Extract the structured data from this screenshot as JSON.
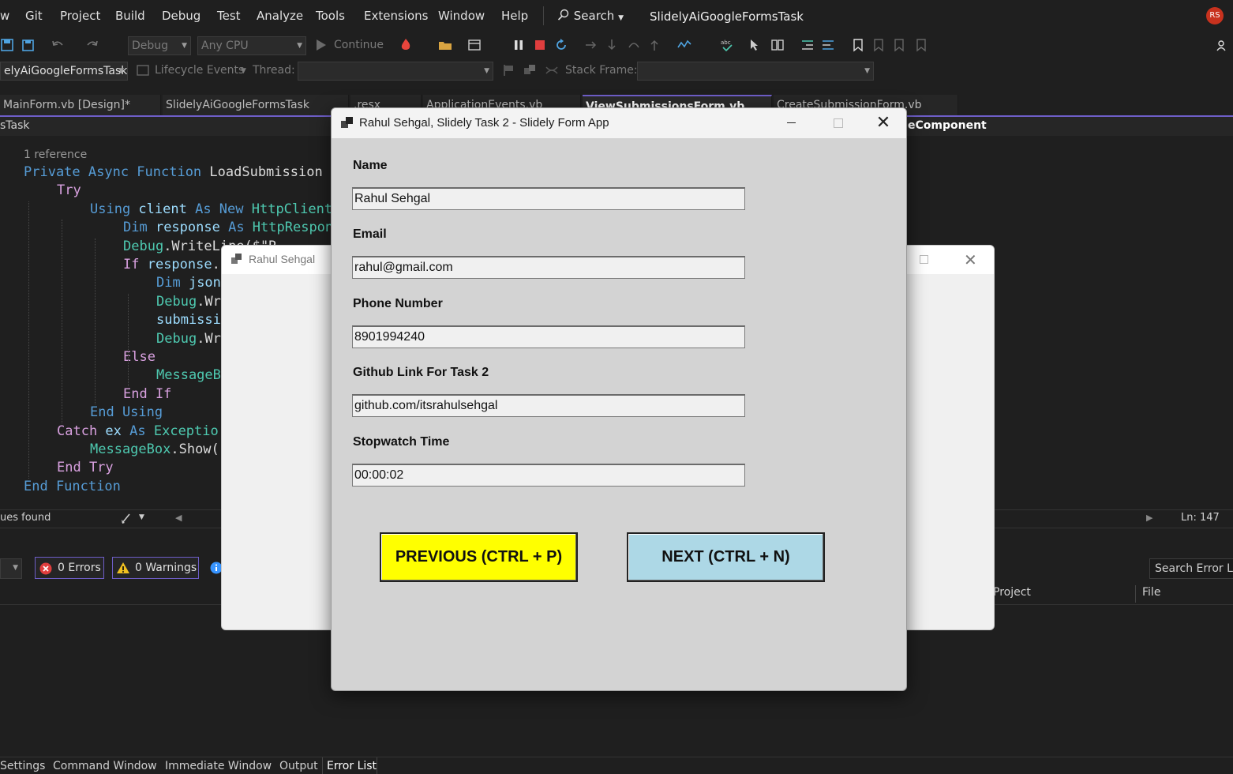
{
  "menubar": {
    "items": [
      "w",
      "Git",
      "Project",
      "Build",
      "Debug",
      "Test",
      "Analyze",
      "Tools",
      "Extensions",
      "Window",
      "Help"
    ],
    "search_label": "Search",
    "solution_name": "SlidelyAiGoogleFormsTask",
    "avatar_initials": "RS"
  },
  "toolbar1": {
    "config": "Debug",
    "platform": "Any CPU",
    "continue_label": "Continue"
  },
  "toolbar2": {
    "startup_project": "elyAiGoogleFormsTask",
    "lifecycle_label": "Lifecycle Events",
    "thread_label": "Thread:",
    "stack_frame_label": "Stack Frame:"
  },
  "tabs": [
    {
      "label": "MainForm.vb [Design]*"
    },
    {
      "label": "SlidelyAiGoogleFormsTask"
    },
    {
      "label": ".resx"
    },
    {
      "label": "ApplicationEvents.vb"
    },
    {
      "label": "ViewSubmissionsForm.vb"
    },
    {
      "label": "CreateSubmissionForm.vb"
    }
  ],
  "navbar": {
    "left": "sTask",
    "right": "eComponent"
  },
  "code": {
    "codelens": "1 reference",
    "lines": [
      {
        "indent": 0,
        "parts": [
          [
            "kw",
            "Private Async Function "
          ],
          [
            "txt",
            "LoadSubmission"
          ]
        ]
      },
      {
        "indent": 1,
        "parts": [
          [
            "ctl",
            "Try"
          ]
        ]
      },
      {
        "indent": 2,
        "parts": [
          [
            "kw",
            "Using "
          ],
          [
            "idf",
            "client "
          ],
          [
            "kw",
            "As New "
          ],
          [
            "typ",
            "HttpClient"
          ]
        ]
      },
      {
        "indent": 3,
        "parts": [
          [
            "kw",
            "Dim "
          ],
          [
            "idf",
            "response "
          ],
          [
            "kw",
            "As "
          ],
          [
            "typ",
            "HttpRespon"
          ]
        ]
      },
      {
        "indent": 3,
        "parts": [
          [
            "typ",
            "Debug"
          ],
          [
            "txt",
            ".WriteLine($\"R"
          ]
        ]
      },
      {
        "indent": 3,
        "parts": [
          [
            "ctl",
            "If "
          ],
          [
            "idf",
            "response"
          ],
          [
            "txt",
            "."
          ]
        ]
      },
      {
        "indent": 4,
        "parts": [
          [
            "kw",
            "Dim "
          ],
          [
            "idf",
            "json"
          ]
        ]
      },
      {
        "indent": 4,
        "parts": [
          [
            "typ",
            "Debug"
          ],
          [
            "txt",
            ".Wr"
          ]
        ]
      },
      {
        "indent": 4,
        "parts": [
          [
            "idf",
            "submissi"
          ]
        ]
      },
      {
        "indent": 4,
        "parts": [
          [
            "typ",
            "Debug"
          ],
          [
            "txt",
            ".Wr"
          ]
        ]
      },
      {
        "indent": 3,
        "parts": [
          [
            "ctl",
            "Else"
          ]
        ]
      },
      {
        "indent": 4,
        "parts": [
          [
            "typ",
            "MessageB"
          ]
        ]
      },
      {
        "indent": 3,
        "parts": [
          [
            "ctl",
            "End If"
          ]
        ]
      },
      {
        "indent": 2,
        "parts": [
          [
            "kw",
            "End Using"
          ]
        ]
      },
      {
        "indent": 1,
        "parts": [
          [
            "ctl",
            "Catch "
          ],
          [
            "idf",
            "ex "
          ],
          [
            "kw",
            "As "
          ],
          [
            "typ",
            "Exceptio"
          ]
        ]
      },
      {
        "indent": 2,
        "parts": [
          [
            "typ",
            "MessageBox"
          ],
          [
            "txt",
            ".Show("
          ]
        ]
      },
      {
        "indent": 1,
        "parts": [
          [
            "ctl",
            "End Try"
          ]
        ]
      },
      {
        "indent": 0,
        "parts": [
          [
            "kw",
            "End Function"
          ]
        ]
      }
    ]
  },
  "editor_status": {
    "issues": "ues found",
    "position": "Ln: 147"
  },
  "error_list": {
    "errors": "0 Errors",
    "warnings": "0 Warnings",
    "search_placeholder": "Search Error List",
    "col_project": "Project",
    "col_file": "File"
  },
  "bottom_tabs": [
    "Settings",
    "Command Window",
    "Immediate Window",
    "Output",
    "Error List"
  ],
  "bg_window": {
    "title": "Rahul Sehgal"
  },
  "dialog": {
    "title": "Rahul Sehgal, Slidely Task 2 - Slidely Form App",
    "fields": [
      {
        "label": "Name",
        "value": "Rahul Sehgal"
      },
      {
        "label": "Email",
        "value": "rahul@gmail.com"
      },
      {
        "label": "Phone Number",
        "value": "8901994240"
      },
      {
        "label": "Github Link For Task 2",
        "value": "github.com/itsrahulsehgal"
      },
      {
        "label": "Stopwatch Time",
        "value": "00:00:02"
      }
    ],
    "prev_button": "PREVIOUS (CTRL + P)",
    "next_button": "NEXT (CTRL + N)"
  },
  "colors": {
    "accent": "#6e5ec8",
    "prev_button_bg": "#ffff00",
    "next_button_bg": "#add8e6",
    "error_icon": "#e03e3e",
    "warning_icon": "#f0c020"
  }
}
